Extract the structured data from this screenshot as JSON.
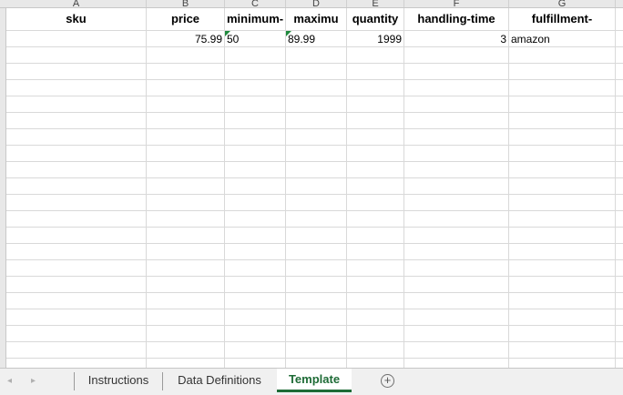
{
  "columns": [
    {
      "letter": "A",
      "header": "sku"
    },
    {
      "letter": "B",
      "header": "price"
    },
    {
      "letter": "C",
      "header": "minimum-"
    },
    {
      "letter": "D",
      "header": "maximu"
    },
    {
      "letter": "E",
      "header": "quantity"
    },
    {
      "letter": "F",
      "header": "handling-time"
    },
    {
      "letter": "G",
      "header": "fulfillment-"
    }
  ],
  "row1": {
    "sku": "",
    "price": "75.99",
    "minimum": "50",
    "maximum": "89.99",
    "quantity": "1999",
    "handling_time": "3",
    "fulfillment": "amazon"
  },
  "tabs": {
    "prev": "◂",
    "next": "▸",
    "items": [
      "Instructions",
      "Data Definitions",
      "Template"
    ],
    "active": "Template",
    "add_symbol": "+"
  },
  "colors": {
    "active_tab": "#1e6b36",
    "error_marker": "#1e8a3c"
  }
}
